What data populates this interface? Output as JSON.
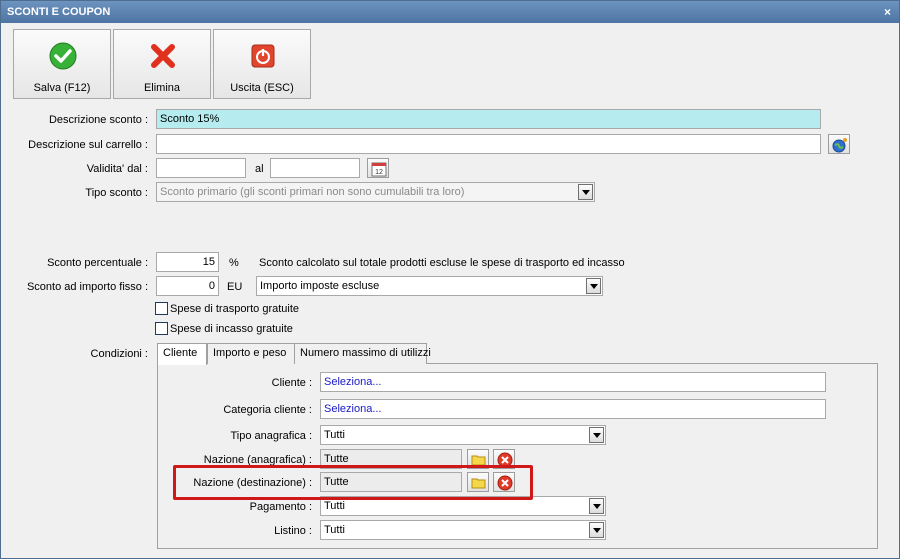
{
  "window": {
    "title": "SCONTI E COUPON",
    "close_glyph": "×"
  },
  "toolbar": {
    "save": {
      "label": "Salva (F12)",
      "icon": "check-icon"
    },
    "delete": {
      "label": "Elimina",
      "icon": "x-icon"
    },
    "exit": {
      "label": "Uscita (ESC)",
      "icon": "power-icon"
    }
  },
  "form": {
    "descrizione_label": "Descrizione sconto :",
    "descrizione_value": "Sconto 15%",
    "carrello_label": "Descrizione sul carrello :",
    "carrello_value": "",
    "validita_label": "Validita' dal :",
    "validita_from": "",
    "al_label": "al",
    "validita_to": "",
    "tipo_label": "Tipo sconto :",
    "tipo_value": "Sconto primario (gli sconti primari non sono cumulabili tra loro)",
    "perc_label": "Sconto percentuale :",
    "perc_value": "15",
    "perc_unit": "%",
    "perc_note": "Sconto calcolato sul totale prodotti escluse le spese di trasporto ed incasso",
    "fisso_label": "Sconto ad importo fisso :",
    "fisso_value": "0",
    "fisso_unit": "EU",
    "fisso_select": "Importo imposte escluse",
    "spese_trasporto": "Spese di trasporto gratuite",
    "spese_incasso": "Spese di incasso gratuite",
    "condizioni_label": "Condizioni :"
  },
  "tabs": [
    "Cliente",
    "Importo e peso",
    "Numero massimo di utilizzi"
  ],
  "cliente_tab": {
    "cliente_label": "Cliente :",
    "cliente_value": "Seleziona...",
    "categoria_label": "Categoria cliente :",
    "categoria_value": "Seleziona...",
    "tipo_anagrafica_label": "Tipo anagrafica :",
    "tipo_anagrafica_value": "Tutti",
    "nazione_anagrafica_label": "Nazione (anagrafica) :",
    "nazione_anagrafica_value": "Tutte",
    "nazione_destinazione_label": "Nazione (destinazione) :",
    "nazione_destinazione_value": "Tutte",
    "pagamento_label": "Pagamento :",
    "pagamento_value": "Tutti",
    "listino_label": "Listino :",
    "listino_value": "Tutti"
  },
  "colors": {
    "highlight": "#b6ecef",
    "title_bar": "#5a80ad",
    "annotation": "#d01818"
  }
}
